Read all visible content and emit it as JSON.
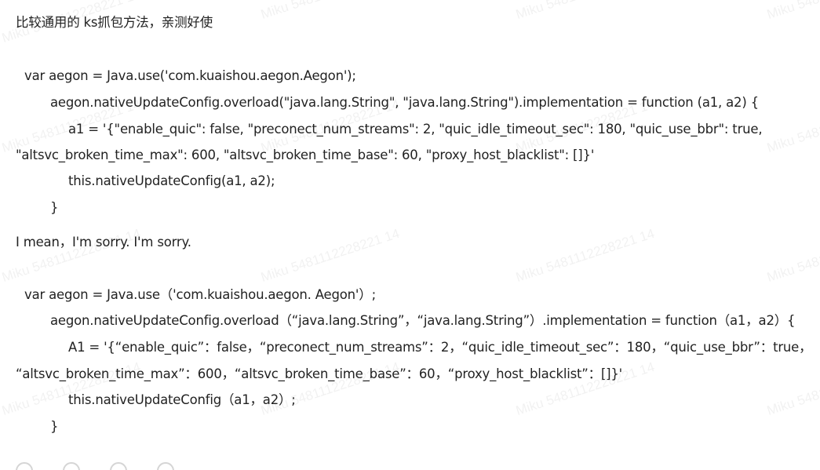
{
  "post": {
    "intro": "比较通用的 ks抓包方法，亲测好使",
    "code1": {
      "l1": "var aegon = Java.use('com.kuaishou.aegon.Aegon');",
      "l2": "aegon.nativeUpdateConfig.overload(\"java.lang.String\", \"java.lang.String\").implementation = function (a1, a2) {",
      "l3": "a1 = '{\"enable_quic\": false, \"preconect_num_streams\": 2, \"quic_idle_timeout_sec\": 180, \"quic_use_bbr\": true,",
      "l4": "\"altsvc_broken_time_max\": 600, \"altsvc_broken_time_base\": 60, \"proxy_host_blacklist\": []}'",
      "l5": "this.nativeUpdateConfig(a1, a2);",
      "l6": "}"
    },
    "translation_note": "I mean，I'm sorry. I'm sorry.",
    "code2": {
      "l1": "var aegon = Java.use（'com.kuaishou.aegon. Aegon'）;",
      "l2": "aegon.nativeUpdateConfig.overload（“java.lang.String”，“java.lang.String”）.implementation = function（a1，a2）{",
      "l3": "A1 = '{“enable_quic”：false，“preconect_num_streams”：2，“quic_idle_timeout_sec”：180，“quic_use_bbr”：true，",
      "l4": "“altsvc_broken_time_max”：600，“altsvc_broken_time_base”：60，“proxy_host_blacklist”：[]}'",
      "l5": "this.nativeUpdateConfig（a1，a2）;",
      "l6": "}"
    }
  },
  "watermark": {
    "text": "Miku 5481112228221 14"
  },
  "icons": [
    "like-icon",
    "bookmark-icon",
    "share-icon",
    "more-icon"
  ]
}
